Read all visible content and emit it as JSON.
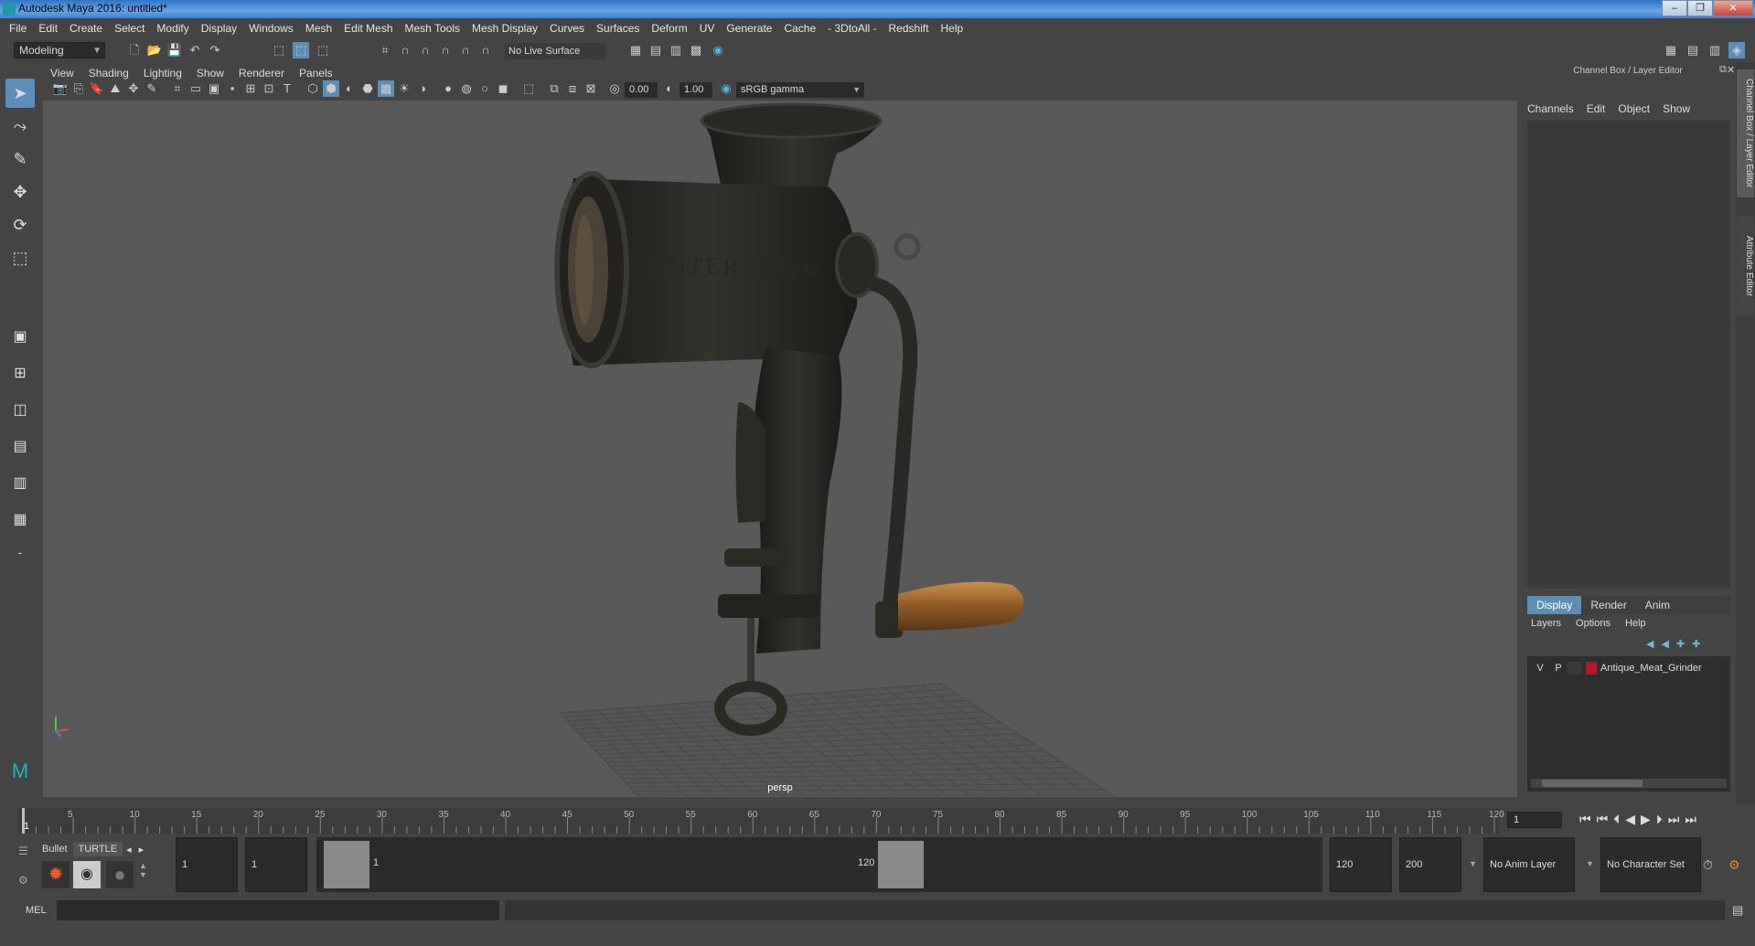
{
  "window": {
    "title": "Autodesk Maya 2016: untitled*",
    "minimize": "–",
    "restore": "❐",
    "close": "✕"
  },
  "menubar": [
    "File",
    "Edit",
    "Create",
    "Select",
    "Modify",
    "Display",
    "Windows",
    "Mesh",
    "Edit Mesh",
    "Mesh Tools",
    "Mesh Display",
    "Curves",
    "Surfaces",
    "Deform",
    "UV",
    "Generate",
    "Cache",
    "- 3DtoAll -",
    "Redshift",
    "Help"
  ],
  "status_line": {
    "mode": "Modeling",
    "live_surface": "No Live Surface"
  },
  "viewport": {
    "menus": [
      "View",
      "Shading",
      "Lighting",
      "Show",
      "Renderer",
      "Panels"
    ],
    "exposure": "0.00",
    "gamma": "1.00",
    "color_space": "sRGB gamma",
    "camera_label": "persp",
    "model_text": "ENTERPRISE"
  },
  "channel_box": {
    "title": "Channel Box / Layer Editor",
    "menus": [
      "Channels",
      "Edit",
      "Object",
      "Show"
    ]
  },
  "layer_editor": {
    "tabs": [
      "Display",
      "Render",
      "Anim"
    ],
    "active_tab": "Display",
    "menus": [
      "Layers",
      "Options",
      "Help"
    ],
    "layers": [
      {
        "v": "V",
        "p": "P",
        "color": "#b01a2a",
        "name": "Antique_Meat_Grinder"
      }
    ]
  },
  "side_tabs": [
    "Channel Box / Layer Editor",
    "Attribute Editor"
  ],
  "timeline": {
    "ticks": [
      "5",
      "10",
      "15",
      "20",
      "25",
      "30",
      "35",
      "40",
      "45",
      "50",
      "55",
      "60",
      "65",
      "70",
      "75",
      "80",
      "85",
      "90",
      "95",
      "100",
      "105",
      "110",
      "115",
      "120"
    ],
    "start_frame": "1",
    "current_frame": "1"
  },
  "shelf": {
    "tabs": [
      "Bullet",
      "TURTLE"
    ],
    "active_tab": "TURTLE"
  },
  "range": {
    "start": "1",
    "playback_start": "1",
    "slider_start": "1",
    "slider_end": "120",
    "playback_end": "120",
    "end": "200",
    "anim_layer": "No Anim Layer",
    "character_set": "No Character Set"
  },
  "command_line": {
    "label": "MEL"
  }
}
